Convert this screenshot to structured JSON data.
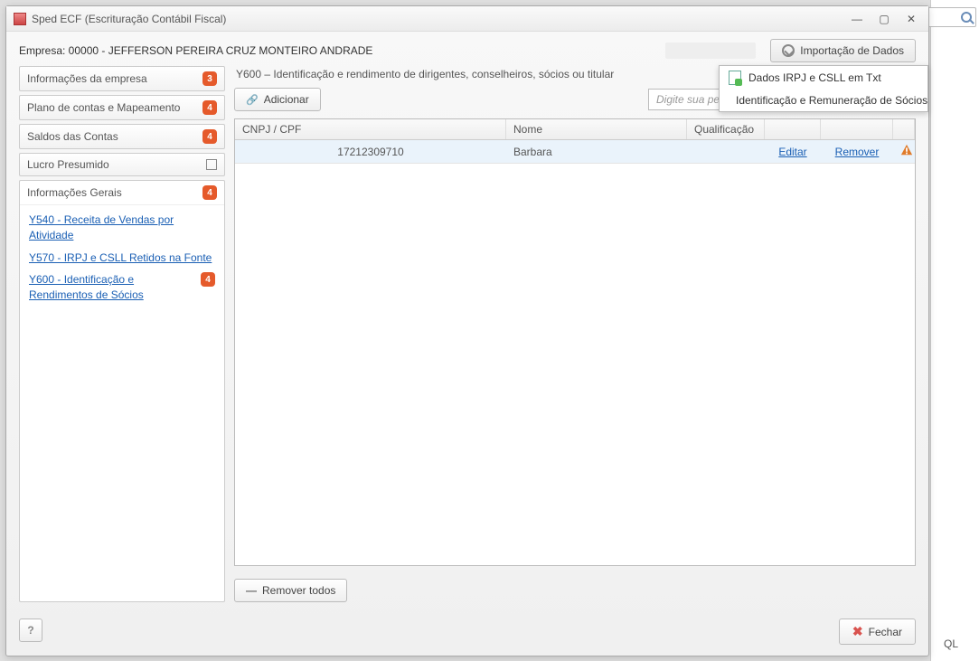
{
  "window": {
    "title": "Sped ECF (Escrituração Contábil Fiscal)"
  },
  "header": {
    "empresa_label": "Empresa: 00000 - JEFFERSON PEREIRA CRUZ MONTEIRO ANDRADE",
    "import_button": "Importação de Dados",
    "import_menu": {
      "item1": "Dados IRPJ e CSLL em Txt",
      "item2": "Identificação e Remuneração de Sócios"
    }
  },
  "sidebar": {
    "sections": {
      "s0": {
        "label": "Informações da empresa",
        "badge": "3"
      },
      "s1": {
        "label": "Plano de contas e Mapeamento",
        "badge": "4"
      },
      "s2": {
        "label": "Saldos das Contas",
        "badge": "4"
      },
      "s3": {
        "label": "Lucro Presumido"
      },
      "s4": {
        "label": "Informações Gerais",
        "badge": "4"
      }
    },
    "links": {
      "l0": "Y540 - Receita de Vendas por Atividade",
      "l1": "Y570 - IRPJ e CSLL Retidos na Fonte",
      "l2": "Y600 - Identificação e Rendimentos de Sócios",
      "l2_badge": "4"
    }
  },
  "main": {
    "section_title": "Y600 – Identificação e rendimento de dirigentes, conselheiros, sócios ou titular",
    "add_button": "Adicionar",
    "search_placeholder": "Digite sua pesquisa aqui...",
    "columns": {
      "cpf": "CNPJ / CPF",
      "nome": "Nome",
      "qual": "Qualificação"
    },
    "rows": {
      "r0": {
        "cpf": "17212309710",
        "nome": "Barbara",
        "editar": "Editar",
        "remover": "Remover"
      }
    },
    "remove_all": "Remover todos"
  },
  "footer": {
    "close": "Fechar",
    "help": "?"
  },
  "bgright": {
    "ql": "QL"
  }
}
